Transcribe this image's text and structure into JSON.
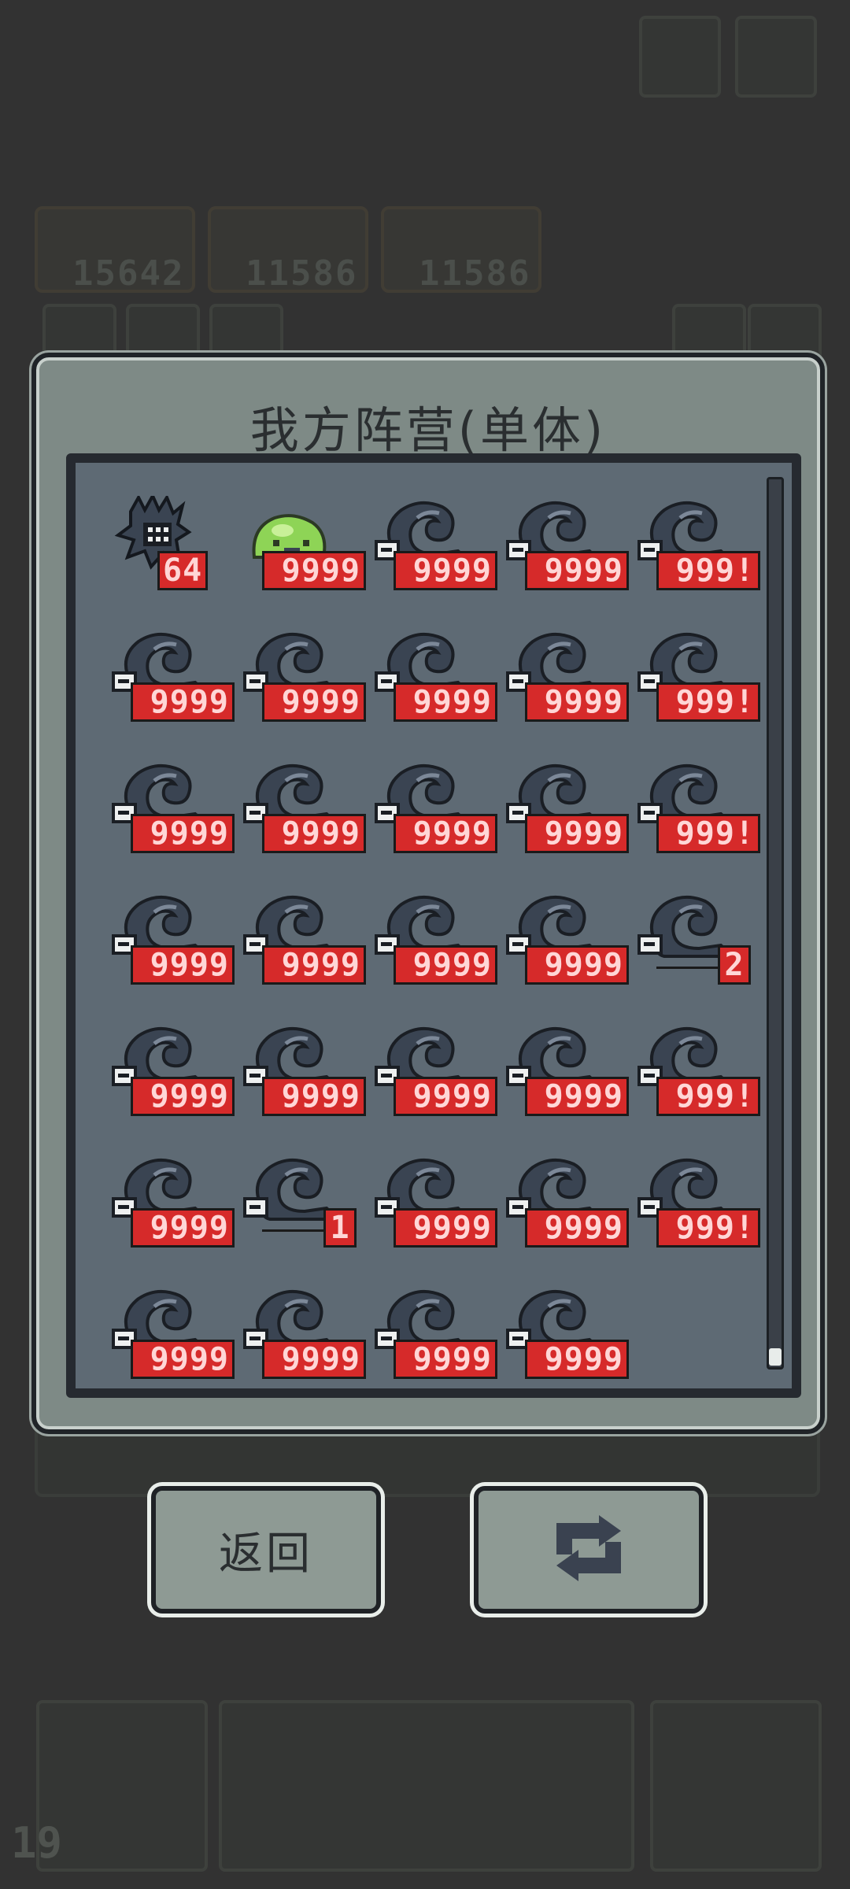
{
  "background": {
    "hp_values": [
      "15642",
      "11586",
      "11586"
    ],
    "level": "19"
  },
  "dialog": {
    "title": "我方阵营(单体)",
    "back_label": "返回",
    "refresh_icon": "refresh-icon"
  },
  "units": [
    {
      "type": "boss",
      "count": "64"
    },
    {
      "type": "slime",
      "count": "9999"
    },
    {
      "type": "whale",
      "count": "9999"
    },
    {
      "type": "whale",
      "count": "9999"
    },
    {
      "type": "whale",
      "count": "999!"
    },
    {
      "type": "whale",
      "count": "9999"
    },
    {
      "type": "whale",
      "count": "9999"
    },
    {
      "type": "whale",
      "count": "9999"
    },
    {
      "type": "whale",
      "count": "9999"
    },
    {
      "type": "whale",
      "count": "999!"
    },
    {
      "type": "whale",
      "count": "9999"
    },
    {
      "type": "whale",
      "count": "9999"
    },
    {
      "type": "whale",
      "count": "9999"
    },
    {
      "type": "whale",
      "count": "9999"
    },
    {
      "type": "whale",
      "count": "999!"
    },
    {
      "type": "whale",
      "count": "9999"
    },
    {
      "type": "whale",
      "count": "9999"
    },
    {
      "type": "whale",
      "count": "9999"
    },
    {
      "type": "whale",
      "count": "9999"
    },
    {
      "type": "whale",
      "count": "2"
    },
    {
      "type": "whale",
      "count": "9999"
    },
    {
      "type": "whale",
      "count": "9999"
    },
    {
      "type": "whale",
      "count": "9999"
    },
    {
      "type": "whale",
      "count": "9999"
    },
    {
      "type": "whale",
      "count": "999!"
    },
    {
      "type": "whale",
      "count": "9999"
    },
    {
      "type": "whale",
      "count": "1"
    },
    {
      "type": "whale",
      "count": "9999"
    },
    {
      "type": "whale",
      "count": "9999"
    },
    {
      "type": "whale",
      "count": "999!"
    },
    {
      "type": "whale",
      "count": "9999"
    },
    {
      "type": "whale",
      "count": "9999"
    },
    {
      "type": "whale",
      "count": "9999"
    },
    {
      "type": "whale",
      "count": "9999"
    }
  ],
  "colors": {
    "count_badge": "#d62a2a",
    "whale": "#3a4452",
    "slime": "#8ed456"
  }
}
